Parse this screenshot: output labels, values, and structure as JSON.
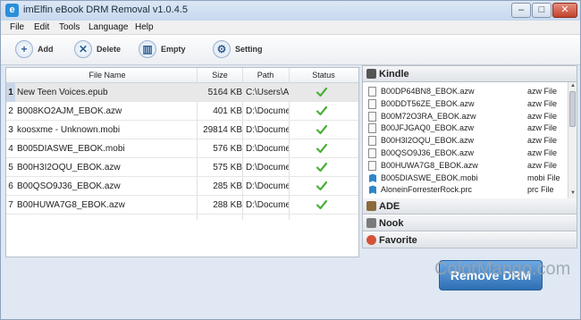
{
  "window": {
    "title": "imElfin eBook DRM Removal v1.0.4.5",
    "app_icon": "ebook-app-icon"
  },
  "menu": [
    "File",
    "Edit",
    "Tools",
    "Language",
    "Help"
  ],
  "toolbar": {
    "add_label": "Add",
    "delete_label": "Delete",
    "empty_label": "Empty",
    "setting_label": "Setting"
  },
  "table": {
    "headers": {
      "name": "File Name",
      "size": "Size",
      "path": "Path",
      "status": "Status"
    },
    "rows": [
      {
        "num": "1",
        "name": "New Teen Voices.epub",
        "size": "5164 KB",
        "path": "C:\\Users\\Adm",
        "status": "done"
      },
      {
        "num": "2",
        "name": "B008KO2AJM_EBOK.azw",
        "size": "401 KB",
        "path": "D:\\Documents",
        "status": "done"
      },
      {
        "num": "3",
        "name": "koosxme - Unknown.mobi",
        "size": "29814 KB",
        "path": "D:\\Documents",
        "status": "done"
      },
      {
        "num": "4",
        "name": "B005DIASWE_EBOK.mobi",
        "size": "576 KB",
        "path": "D:\\Documents",
        "status": "done"
      },
      {
        "num": "5",
        "name": "B00H3I2OQU_EBOK.azw",
        "size": "575 KB",
        "path": "D:\\Documents",
        "status": "done"
      },
      {
        "num": "6",
        "name": "B00QSO9J36_EBOK.azw",
        "size": "285 KB",
        "path": "D:\\Documents",
        "status": "done"
      },
      {
        "num": "7",
        "name": "B00HUWA7G8_EBOK.azw",
        "size": "288 KB",
        "path": "D:\\Documents",
        "status": "done"
      }
    ]
  },
  "library": {
    "kindle_label": "Kindle",
    "ade_label": "ADE",
    "nook_label": "Nook",
    "favorite_label": "Favorite",
    "kindle_items": [
      {
        "name": "B00DP64BN8_EBOK.azw",
        "type": "azw File"
      },
      {
        "name": "B00DDT56ZE_EBOK.azw",
        "type": "azw File"
      },
      {
        "name": "B00M72O3RA_EBOK.azw",
        "type": "azw File"
      },
      {
        "name": "B00JFJGAQ0_EBOK.azw",
        "type": "azw File"
      },
      {
        "name": "B00H3I2OQU_EBOK.azw",
        "type": "azw File"
      },
      {
        "name": "B00QSO9J36_EBOK.azw",
        "type": "azw File"
      },
      {
        "name": "B00HUWA7G8_EBOK.azw",
        "type": "azw File"
      },
      {
        "name": "B005DIASWE_EBOK.mobi",
        "type": "mobi File"
      },
      {
        "name": "AloneinForresterRock.prc",
        "type": "prc File"
      }
    ]
  },
  "remove_button": "Remove DRM",
  "watermark": "ColorMango.com",
  "colors": {
    "accent": "#2d6fb4",
    "check": "#4caf3a",
    "close": "#c2422b"
  }
}
